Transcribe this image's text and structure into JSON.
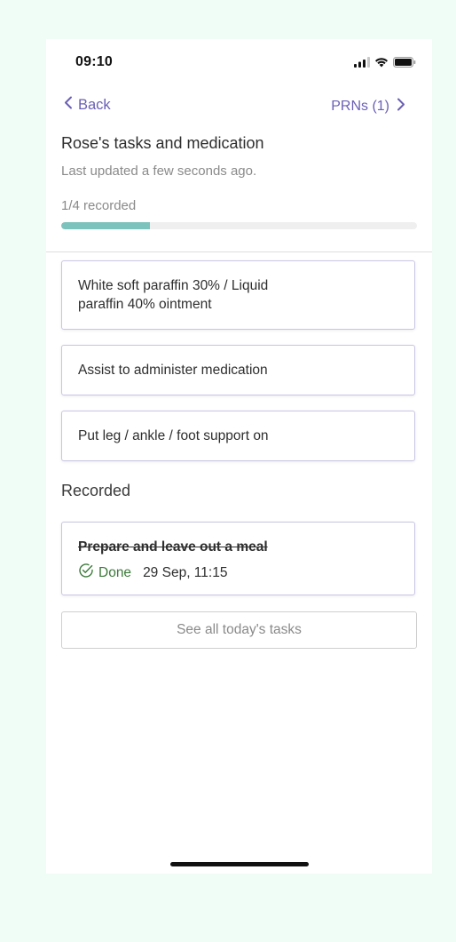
{
  "status_bar": {
    "time": "09:10"
  },
  "nav": {
    "back_label": "Back",
    "prn_label": "PRNs (1)"
  },
  "header": {
    "title": "Rose's tasks and medication",
    "last_updated": "Last updated a few seconds ago.",
    "progress_label": "1/4 recorded",
    "progress_fraction": 0.25
  },
  "pending_tasks": [
    {
      "label": "White soft paraffin 30% / Liquid paraffin 40% ointment"
    },
    {
      "label": "Assist to administer medication"
    },
    {
      "label": "Put leg / ankle / foot support on"
    }
  ],
  "recorded": {
    "heading": "Recorded",
    "items": [
      {
        "label": "Prepare and leave out a meal",
        "status": "Done",
        "time": "29 Sep, 11:15"
      }
    ]
  },
  "footer": {
    "see_all_label": "See all today's tasks"
  },
  "colors": {
    "background": "#effdf6",
    "accent": "#6a5fb5",
    "progress_fill": "#7dc3bd",
    "done_green": "#3c7a3a",
    "card_border": "#c9c6e2"
  },
  "icons": {
    "back": "chevron-left-icon",
    "prn": "chevron-right-icon",
    "done": "check-circle-icon",
    "signal": "cellular-signal-icon",
    "wifi": "wifi-icon",
    "battery": "battery-icon"
  }
}
